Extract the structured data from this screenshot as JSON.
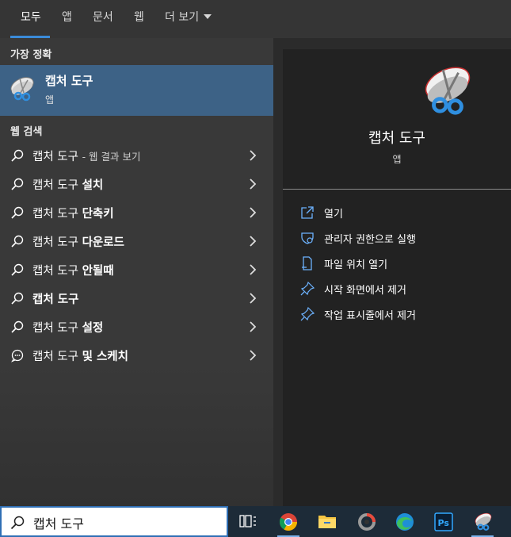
{
  "tabs": [
    {
      "label": "모두",
      "active": true
    },
    {
      "label": "앱"
    },
    {
      "label": "문서"
    },
    {
      "label": "웹"
    },
    {
      "label": "더 보기"
    }
  ],
  "best_match": {
    "heading": "가장 정확",
    "title": "캡처 도구",
    "subtitle": "앱",
    "icon": "snipping-tool-icon"
  },
  "web_search": {
    "heading": "웹 검색",
    "items": [
      {
        "query": "캡처 도구",
        "bold": "",
        "suffix": "- 웹 결과 보기",
        "icon": "search-icon"
      },
      {
        "query": "캡처 도구 ",
        "bold": "설치",
        "suffix": "",
        "icon": "search-icon"
      },
      {
        "query": "캡처 도구 ",
        "bold": "단축키",
        "suffix": "",
        "icon": "search-icon"
      },
      {
        "query": "캡처 도구 ",
        "bold": "다운로드",
        "suffix": "",
        "icon": "search-icon"
      },
      {
        "query": "캡처 도구 ",
        "bold": "안될때",
        "suffix": "",
        "icon": "search-icon"
      },
      {
        "query": "",
        "bold": "캡처 도구",
        "suffix": "",
        "icon": "search-icon"
      },
      {
        "query": "캡처 도구 ",
        "bold": "설정",
        "suffix": "",
        "icon": "search-icon"
      },
      {
        "query": "캡처 도구 ",
        "bold": "및 스케치",
        "suffix": "",
        "icon": "chat-icon"
      }
    ]
  },
  "detail": {
    "app_name": "캡처 도구",
    "app_type": "앱",
    "actions": [
      {
        "label": "열기",
        "icon": "open-icon"
      },
      {
        "label": "관리자 권한으로 실행",
        "icon": "shield-icon"
      },
      {
        "label": "파일 위치 열기",
        "icon": "file-location-icon"
      },
      {
        "label": "시작 화면에서 제거",
        "icon": "unpin-icon"
      },
      {
        "label": "작업 표시줄에서 제거",
        "icon": "unpin-icon"
      }
    ]
  },
  "taskbar": {
    "search_value": "캡처 도구",
    "apps": [
      "task-view-icon",
      "chrome-icon",
      "file-explorer-icon",
      "app-icon",
      "edge-icon",
      "photoshop-icon",
      "snipping-tool-icon"
    ]
  },
  "colors": {
    "accent": "#3b8bd9",
    "selected_row": "#3d6286",
    "taskbar": "#1d2b38"
  }
}
